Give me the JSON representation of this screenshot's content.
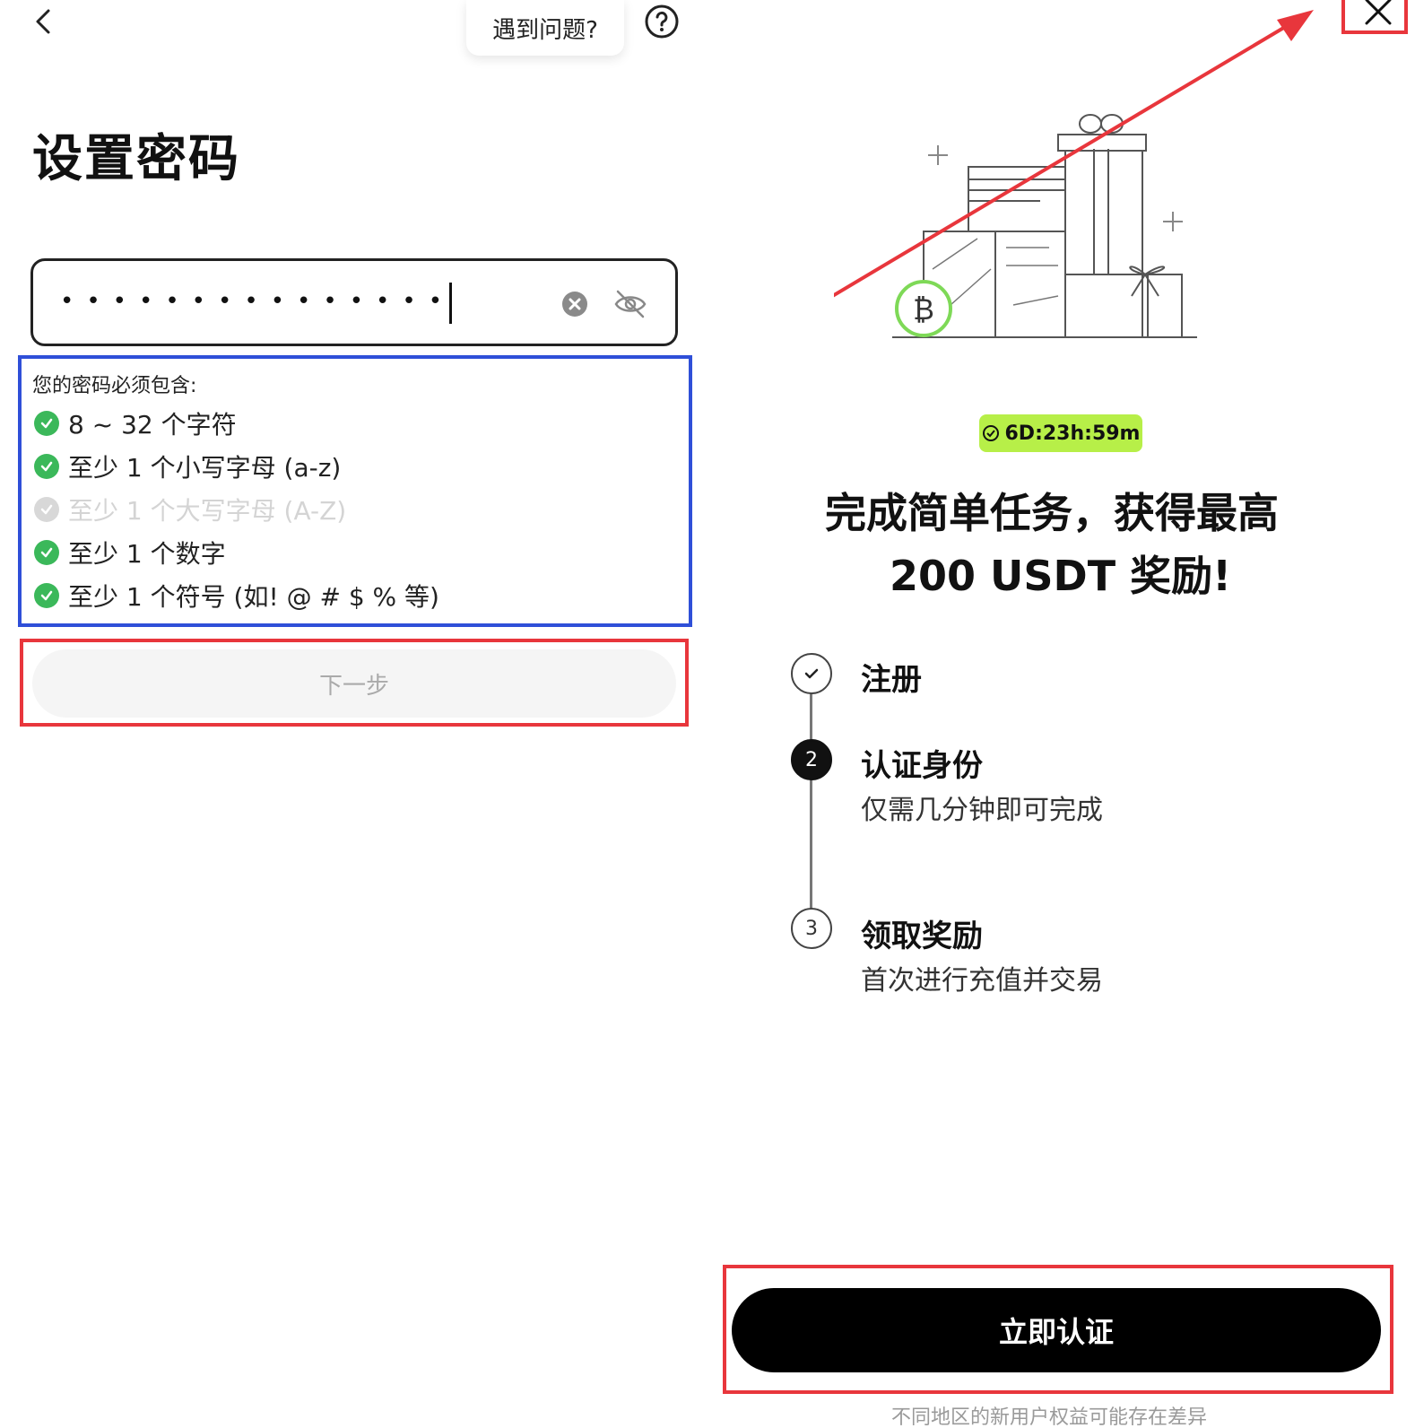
{
  "header": {
    "help_text": "遇到问题?"
  },
  "page_title": "设置密码",
  "password": {
    "masked_value": "•••••••••••••••"
  },
  "rules": {
    "title": "您的密码必须包含:",
    "items": [
      {
        "label": "8 ~ 32 个字符",
        "met": true
      },
      {
        "label": "至少 1 个小写字母 (a-z)",
        "met": true
      },
      {
        "label": "至少 1 个大写字母 (A-Z)",
        "met": false
      },
      {
        "label": "至少 1 个数字",
        "met": true
      },
      {
        "label": "至少 1 个符号 (如! @ # $ % 等)",
        "met": true
      }
    ]
  },
  "next_button": "下一步",
  "promo": {
    "timer": "6D:23h:59m",
    "line1": "完成简单任务，获得最高",
    "line2_highlight": "200 USDT",
    "line2_rest": " 奖励!"
  },
  "steps": [
    {
      "index": "",
      "title": "注册",
      "desc": "",
      "state": "done"
    },
    {
      "index": "2",
      "title": "认证身份",
      "desc": "仅需几分钟即可完成",
      "state": "active"
    },
    {
      "index": "3",
      "title": "领取奖励",
      "desc": "首次进行充值并交易",
      "state": "pending"
    }
  ],
  "verify_button": "立即认证",
  "footnote": "不同地区的新用户权益可能存在差异",
  "colors": {
    "accent_green": "#b7ef48",
    "check_green": "#3bb85a",
    "annotation_red": "#e8363c",
    "annotation_blue": "#2f4fd8"
  }
}
